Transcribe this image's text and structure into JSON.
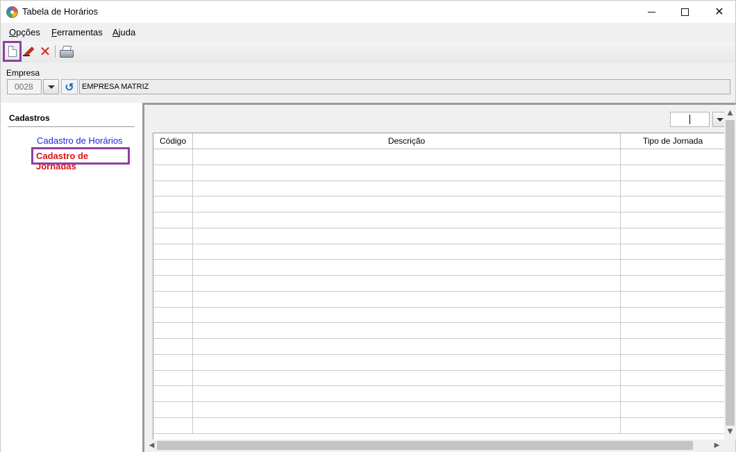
{
  "window": {
    "title": "Tabela de Horários",
    "icon": "app-logo-icon"
  },
  "menu": {
    "items": [
      {
        "underline": "O",
        "rest": "pções"
      },
      {
        "underline": "F",
        "rest": "erramentas"
      },
      {
        "underline": "A",
        "rest": "juda"
      }
    ]
  },
  "toolbar": {
    "buttons": [
      "new-document-icon",
      "edit-pencil-icon",
      "delete-x-icon",
      "print-icon"
    ],
    "highlight_color": "#8e3fa0"
  },
  "empresa": {
    "label": "Empresa",
    "code": "0028",
    "name": "EMPRESA MATRIZ"
  },
  "sidebar": {
    "title": "Cadastros",
    "links": [
      {
        "label": "Cadastro de Horários",
        "color": "#2323d8"
      },
      {
        "label": "Cadastro de Jornadas",
        "color": "#e01010",
        "selected": true
      }
    ]
  },
  "grid": {
    "columns": [
      "Código",
      "Descrição",
      "Tipo de Jornada"
    ],
    "row_count": 18
  }
}
